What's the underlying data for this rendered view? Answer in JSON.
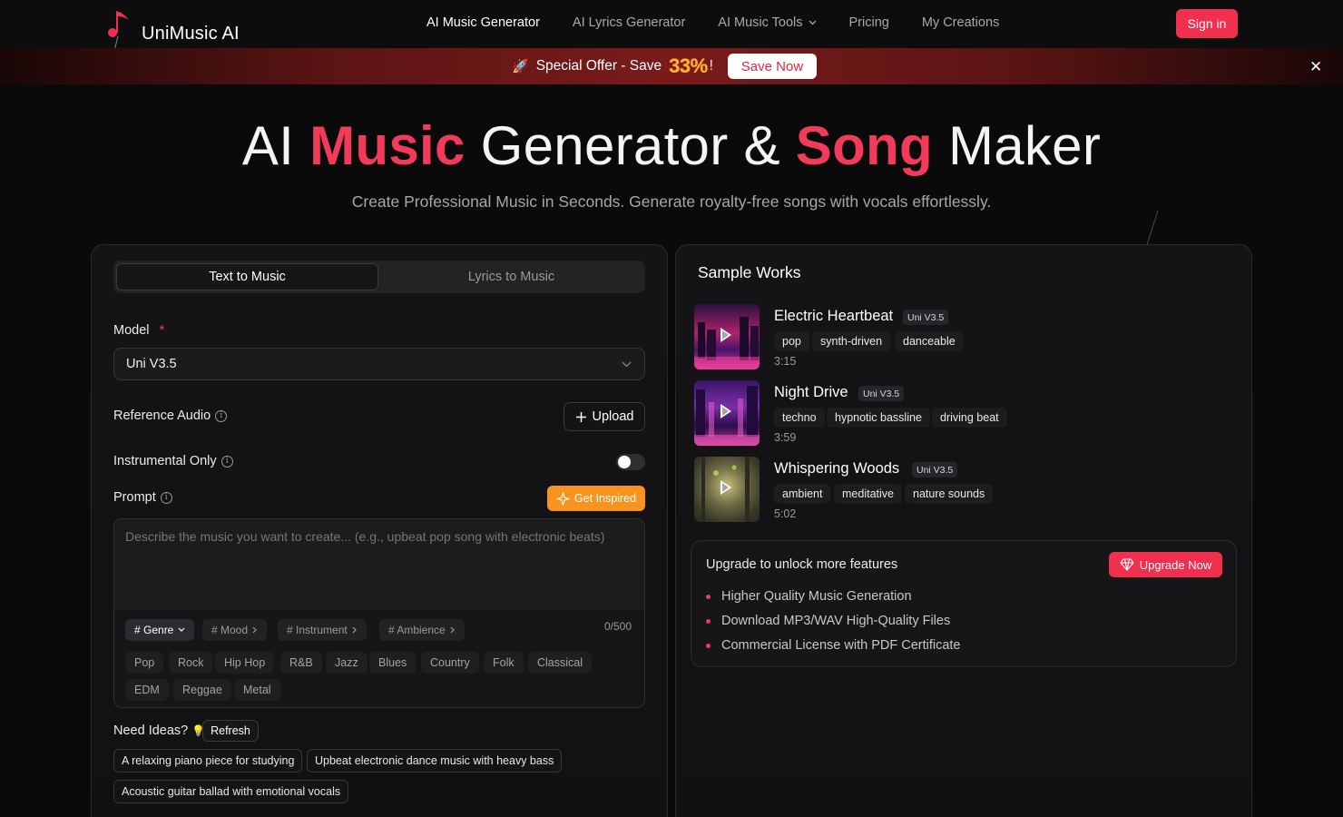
{
  "nav": {
    "brand": "UniMusic AI",
    "links": [
      {
        "label": "AI Music Generator",
        "active": true
      },
      {
        "label": "AI Lyrics Generator",
        "active": false
      },
      {
        "label": "AI Music Tools",
        "active": false,
        "dropdown": true
      },
      {
        "label": "Pricing",
        "active": false
      },
      {
        "label": "My Creations",
        "active": false
      }
    ],
    "signin_label": "Sign in"
  },
  "offer": {
    "icon": "rocket-icon",
    "text": "Special Offer - Save",
    "percent": "33%",
    "suffix": "!",
    "button_label": "Save Now"
  },
  "hero": {
    "title_part1": "AI",
    "title_accent1": "Music",
    "title_part2": "Generator &",
    "title_accent2": "Song",
    "title_part3": "Maker",
    "subtitle": "Create Professional Music in Seconds. Generate royalty-free songs with vocals effortlessly."
  },
  "form": {
    "tabs": [
      {
        "label": "Text to Music",
        "active": true
      },
      {
        "label": "Lyrics to Music",
        "active": false
      }
    ],
    "model_label": "Model",
    "required_mark": "*",
    "model_value": "Uni V3.5",
    "reference_audio_label": "Reference Audio",
    "upload_label": "Upload",
    "instrumental_label": "Instrumental Only",
    "instrumental_on": false,
    "prompt_label": "Prompt",
    "get_inspired_label": "Get Inspired",
    "prompt_placeholder": "Describe the music you want to create... (e.g., upbeat pop song with electronic beats)",
    "prompt_value": "",
    "counter": "0/500",
    "categories": [
      "# Genre",
      "# Mood",
      "# Instrument",
      "# Ambience"
    ],
    "genres": [
      "Pop",
      "Rock",
      "Hip Hop",
      "R&B",
      "Jazz",
      "Blues",
      "Country",
      "Folk",
      "Classical",
      "EDM",
      "Reggae",
      "Metal"
    ],
    "ideas_label": "Need Ideas?",
    "refresh_label": "Refresh",
    "ideas": [
      "A relaxing piano piece for studying",
      "Upbeat electronic dance music with heavy bass",
      "Acoustic guitar ballad with emotional vocals"
    ]
  },
  "samples": {
    "title": "Sample Works",
    "tracks": [
      {
        "title": "Electric Heartbeat",
        "version": "Uni V3.5",
        "tags": [
          "pop",
          "synth-driven",
          "danceable"
        ],
        "duration": "3:15"
      },
      {
        "title": "Night Drive",
        "version": "Uni V3.5",
        "tags": [
          "techno",
          "hypnotic bassline",
          "driving beat"
        ],
        "duration": "3:59"
      },
      {
        "title": "Whispering Woods",
        "version": "Uni V3.5",
        "tags": [
          "ambient",
          "meditative",
          "nature sounds"
        ],
        "duration": "5:02"
      }
    ],
    "upgrade": {
      "heading": "Upgrade to unlock more features",
      "button_label": "Upgrade Now",
      "features": [
        "Higher Quality Music Generation",
        "Download MP3/WAV High-Quality Files",
        "Commercial License with PDF Certificate"
      ]
    }
  },
  "colors": {
    "accent": "#f0304e",
    "offer_percent": "#ffb13b",
    "inspire_button": "#f7931e"
  }
}
